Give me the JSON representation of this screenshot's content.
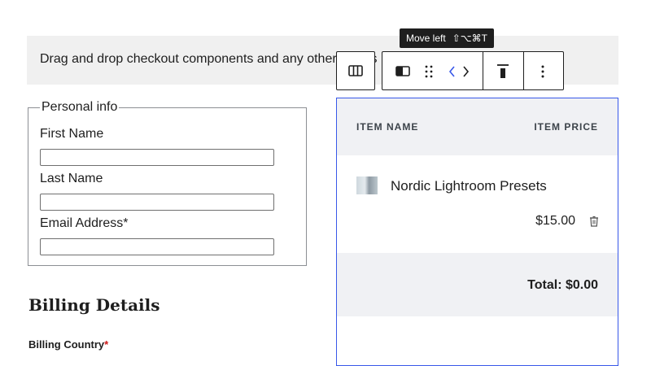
{
  "notice": {
    "text": "Drag and drop checkout components and any other blocks"
  },
  "personal_info": {
    "legend": "Personal info",
    "fields": [
      {
        "label": "First Name",
        "value": ""
      },
      {
        "label": "Last Name",
        "value": ""
      },
      {
        "label": "Email Address*",
        "value": ""
      }
    ]
  },
  "billing": {
    "heading": "Billing Details",
    "country_label": "Billing Country",
    "required_mark": "*"
  },
  "cart": {
    "col_name": "ITEM NAME",
    "col_price": "ITEM PRICE",
    "items": [
      {
        "name": "Nordic Lightroom Presets",
        "price": "$15.00"
      }
    ],
    "total": "Total: $0.00"
  },
  "tooltip": {
    "label": "Move left",
    "shortcut": "⇧⌥⌘T"
  },
  "toolbar": {
    "icons": [
      "columns-icon",
      "column-icon",
      "drag-handle-icon",
      "move-left-icon",
      "move-right-icon",
      "align-top-icon",
      "more-options-icon"
    ]
  },
  "colors": {
    "accent": "#3858e9",
    "required": "#cc1818",
    "dark": "#1e1e1e"
  }
}
